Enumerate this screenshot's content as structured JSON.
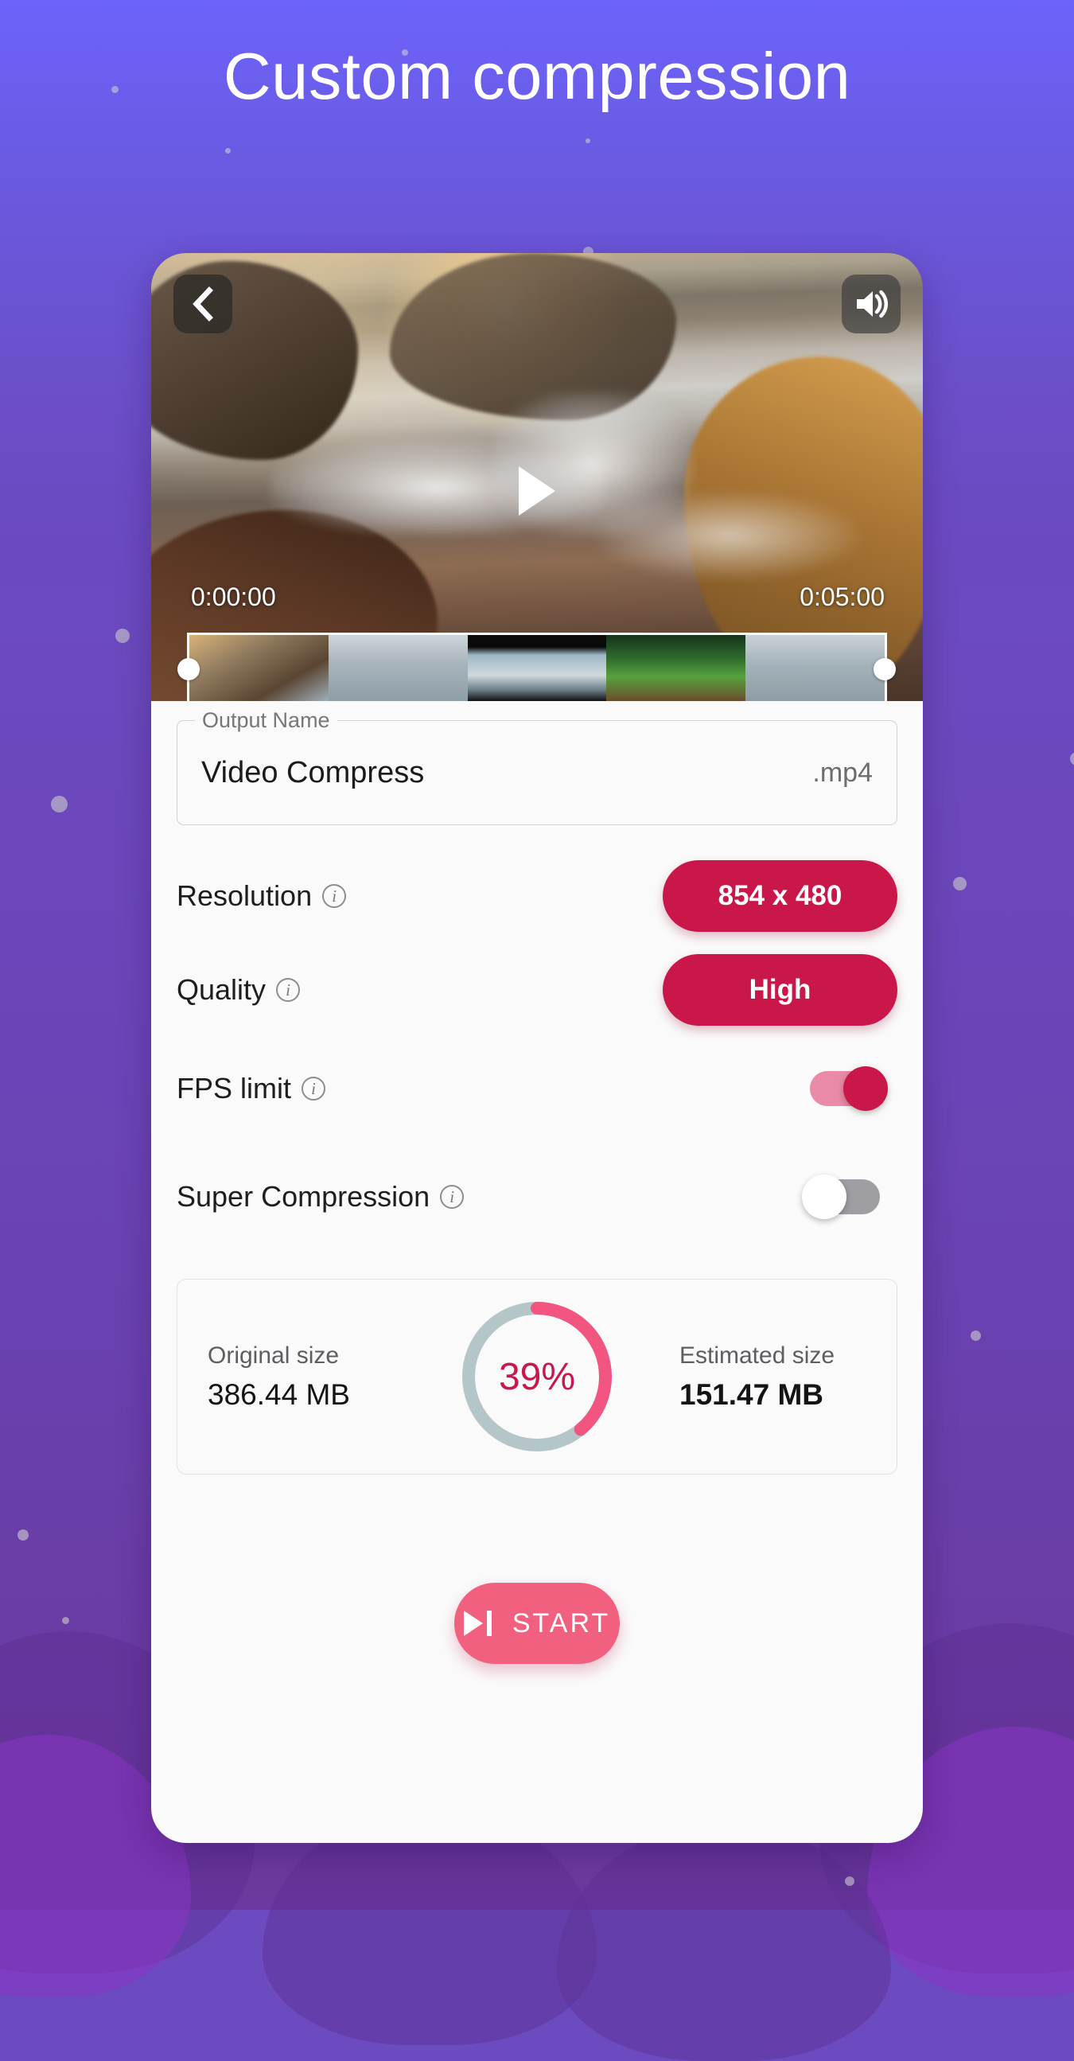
{
  "page": {
    "title": "Custom compression",
    "background_top": "#6c63fb",
    "background_bottom": "#6c3a9e",
    "accent_crimson": "#c9174a",
    "accent_pink": "#f2607f"
  },
  "player": {
    "back_icon": "chevron-left-icon",
    "volume_icon": "volume-up-icon",
    "play_icon": "play-icon",
    "time_start": "0:00:00",
    "time_end": "0:05:00",
    "trim_handle_left": "trim-handle-left",
    "trim_handle_right": "trim-handle-right"
  },
  "output": {
    "label": "Output Name",
    "value": "Video Compress",
    "placeholder": "Video Compress",
    "extension": ".mp4"
  },
  "settings": {
    "resolution": {
      "label": "Resolution",
      "info_icon": "info-icon",
      "value": "854 x 480"
    },
    "quality": {
      "label": "Quality",
      "info_icon": "info-icon",
      "value": "High"
    },
    "fps_limit": {
      "label": "FPS limit",
      "info_icon": "info-icon",
      "state": "on"
    },
    "super_compression": {
      "label": "Super Compression",
      "info_icon": "info-icon",
      "state": "off"
    }
  },
  "size_card": {
    "original_label": "Original size",
    "original_value": "386.44 MB",
    "estimated_label": "Estimated size",
    "estimated_value": "151.47 MB",
    "percent_text": "39%",
    "percent_value": 39,
    "arc_color": "#f2557f",
    "track_color": "#b5c6c9"
  },
  "start": {
    "label": "START",
    "icon": "skip-next-icon"
  }
}
